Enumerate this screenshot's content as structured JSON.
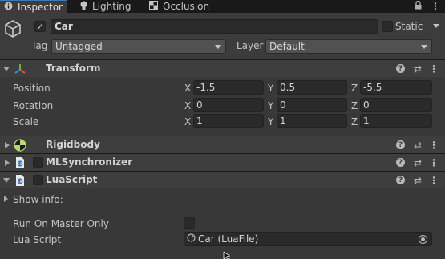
{
  "tabs": [
    {
      "label": "Inspector",
      "icon": "info-icon",
      "active": true
    },
    {
      "label": "Lighting",
      "icon": "lightbulb-icon",
      "active": false
    },
    {
      "label": "Occlusion",
      "icon": "occlusion-icon",
      "active": false
    }
  ],
  "header": {
    "active_checked": true,
    "name": "Car",
    "static_label": "Static",
    "static_checked": false,
    "tag_label": "Tag",
    "tag_value": "Untagged",
    "layer_label": "Layer",
    "layer_value": "Default"
  },
  "transform": {
    "title": "Transform",
    "position_label": "Position",
    "rotation_label": "Rotation",
    "scale_label": "Scale",
    "axis_x": "X",
    "axis_y": "Y",
    "axis_z": "Z",
    "position": {
      "x": "-1.5",
      "y": "0.5",
      "z": "-5.5"
    },
    "rotation": {
      "x": "0",
      "y": "0",
      "z": "0"
    },
    "scale": {
      "x": "1",
      "y": "1",
      "z": "1"
    }
  },
  "components": [
    {
      "title": "Rigidbody"
    },
    {
      "title": "MLSynchronizer"
    },
    {
      "title": "LuaScript"
    }
  ],
  "luascript": {
    "show_info_label": "Show info:",
    "run_on_master_label": "Run On Master Only",
    "run_on_master_checked": false,
    "lua_script_label": "Lua Script",
    "lua_script_value": "Car (LuaFile)"
  },
  "colors": {
    "background": "#383838",
    "tab_accent": "#3a79bb",
    "field_bg": "#2a2a2a"
  }
}
